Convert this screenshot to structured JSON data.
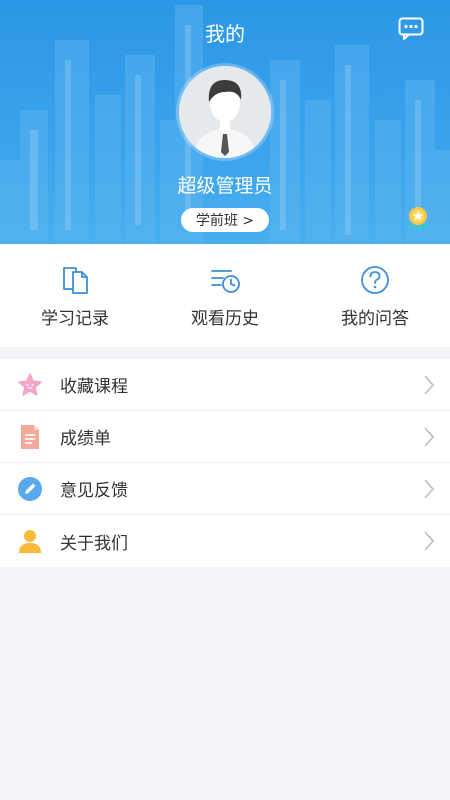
{
  "header": {
    "title": "我的",
    "username": "超级管理员",
    "class_label": "学前班 >"
  },
  "quick_actions": [
    {
      "label": "学习记录",
      "icon": "document-copy-icon"
    },
    {
      "label": "观看历史",
      "icon": "history-list-icon"
    },
    {
      "label": "我的问答",
      "icon": "question-circle-icon"
    }
  ],
  "menu": [
    {
      "label": "收藏课程",
      "icon": "star-icon",
      "color": "#f3a6c8"
    },
    {
      "label": "成绩单",
      "icon": "report-icon",
      "color": "#f4a99a"
    },
    {
      "label": "意见反馈",
      "icon": "pencil-icon",
      "color": "#5aa9ec"
    },
    {
      "label": "关于我们",
      "icon": "person-icon",
      "color": "#f6bb3a"
    }
  ],
  "colors": {
    "header_blue": "#2c97e6",
    "quick_icon": "#3d8fd8"
  }
}
